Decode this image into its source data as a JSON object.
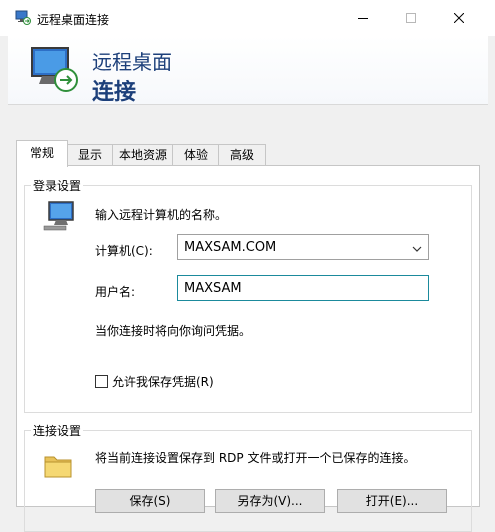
{
  "window": {
    "title": "远程桌面连接"
  },
  "header": {
    "line1": "远程桌面",
    "line2": "连接"
  },
  "tabs": [
    {
      "label": "常规"
    },
    {
      "label": "显示"
    },
    {
      "label": "本地资源"
    },
    {
      "label": "体验"
    },
    {
      "label": "高级"
    }
  ],
  "login": {
    "group_title": "登录设置",
    "instruction": "输入远程计算机的名称。",
    "computer_label": "计算机(C):",
    "computer_value": "MAXSAM.COM",
    "username_label": "用户名:",
    "username_value": "MAXSAM",
    "note": "当你连接时将向你询问凭据。",
    "save_credentials_label": "允许我保存凭据(R)",
    "save_credentials_checked": false
  },
  "connection": {
    "group_title": "连接设置",
    "description": "将当前连接设置保存到 RDP 文件或打开一个已保存的连接。",
    "buttons": [
      {
        "label": "保存(S)"
      },
      {
        "label": "另存为(V)..."
      },
      {
        "label": "打开(E)..."
      }
    ]
  },
  "icons": {
    "app": "remote-desktop-icon",
    "hero": "remote-desktop-icon",
    "computer": "computer-icon",
    "folder": "folder-icon"
  }
}
